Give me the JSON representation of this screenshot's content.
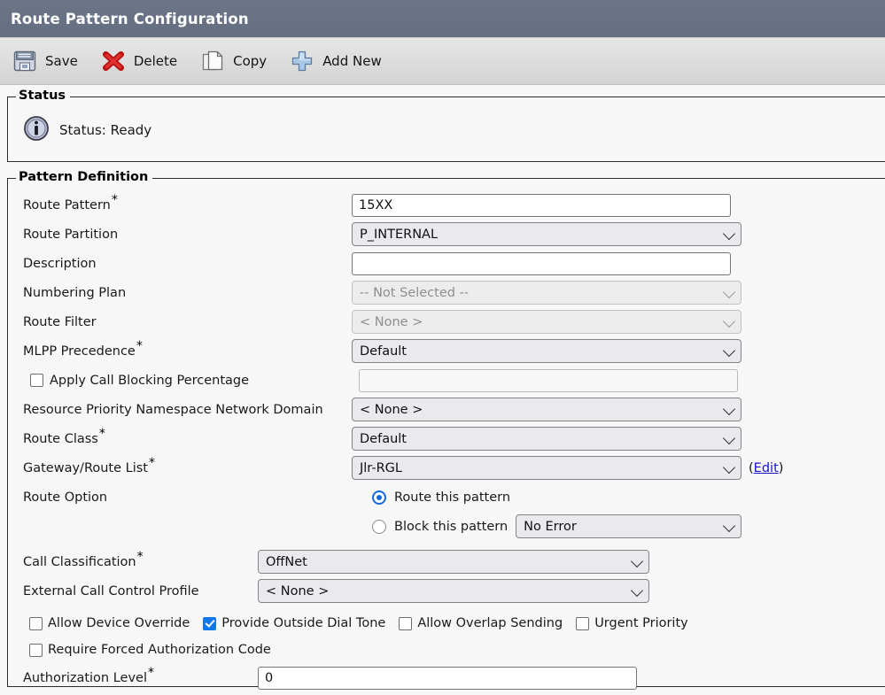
{
  "window": {
    "title": "Route Pattern Configuration"
  },
  "toolbar": {
    "buttons": [
      {
        "label": "Save",
        "icon": "save-icon"
      },
      {
        "label": "Delete",
        "icon": "delete-icon"
      },
      {
        "label": "Copy",
        "icon": "copy-icon"
      },
      {
        "label": "Add New",
        "icon": "add-new-icon"
      }
    ]
  },
  "status": {
    "legend": "Status",
    "icon": "info-icon",
    "text": "Status: Ready"
  },
  "pattern": {
    "legend": "Pattern Definition",
    "fields": {
      "route_pattern": {
        "label": "Route Pattern",
        "required": "*",
        "value": "15XX"
      },
      "route_partition": {
        "label": "Route Partition",
        "value": "P_INTERNAL"
      },
      "description": {
        "label": "Description",
        "value": "",
        "placeholder": ""
      },
      "numbering_plan": {
        "label": "Numbering Plan",
        "value": "-- Not Selected --"
      },
      "route_filter": {
        "label": "Route Filter",
        "value": "< None >"
      },
      "mlpp_precedence": {
        "label": "MLPP Precedence",
        "required": "*",
        "value": "Default"
      },
      "apply_call_blocking": {
        "label": "Apply Call Blocking Percentage",
        "value": ""
      },
      "rpnnd": {
        "label": "Resource Priority Namespace Network Domain",
        "value": "< None >"
      },
      "route_class": {
        "label": "Route Class",
        "required": "*",
        "value": "Default"
      },
      "gateway_route_list": {
        "label": "Gateway/Route List",
        "required": "*",
        "value": "Jlr-RGL",
        "edit_label": "Edit",
        "paren_open": "(",
        "paren_close": ")"
      },
      "route_option": {
        "label": "Route Option",
        "option_route": "Route this pattern",
        "option_block": "Block this pattern",
        "block_reason": "No Error"
      },
      "call_classification": {
        "label": "Call Classification",
        "required": "*",
        "value": "OffNet"
      },
      "external_ccp": {
        "label": "External Call Control Profile",
        "value": "< None >"
      },
      "authorization_level": {
        "label": "Authorization Level",
        "required": "*",
        "value": "0"
      }
    },
    "checkboxes": [
      {
        "label": "Allow Device Override",
        "checked": false
      },
      {
        "label": "Provide Outside Dial Tone",
        "checked": true
      },
      {
        "label": "Allow Overlap Sending",
        "checked": false
      },
      {
        "label": "Urgent Priority",
        "checked": false
      },
      {
        "label": "Require Forced Authorization Code",
        "checked": false
      }
    ]
  },
  "colors": {
    "titlebar": "#69738a",
    "accent_checked": "#1176e8",
    "radio_on": "#1468d8",
    "link": "#1414cc"
  }
}
